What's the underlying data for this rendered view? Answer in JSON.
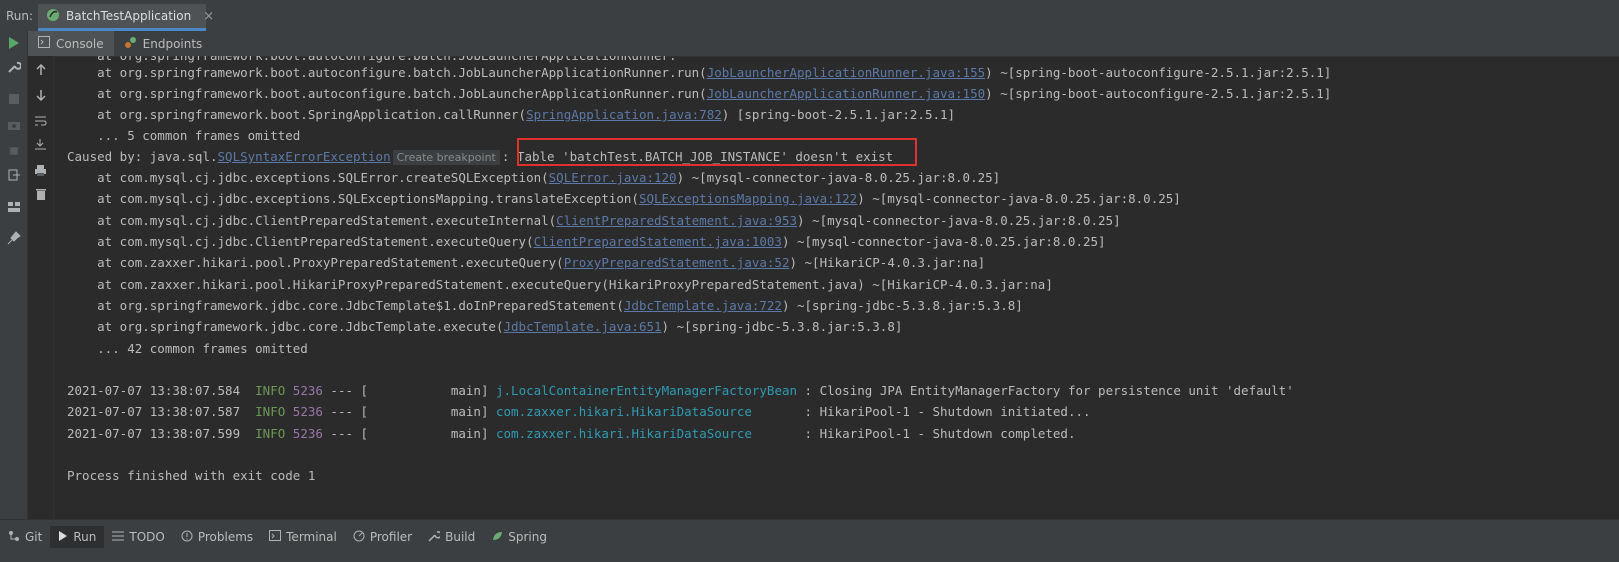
{
  "run_bar": {
    "label": "Run:",
    "tab_label": "BatchTestApplication"
  },
  "tool_tabs": [
    {
      "label": "Console",
      "icon": "console-icon"
    },
    {
      "label": "Endpoints",
      "icon": "endpoints-icon"
    }
  ],
  "console": {
    "lines": [
      "    at org.springframework.boot.autoconfigure.batch.JobLauncherApplicationRunner.run(",
      "    at org.springframework.boot.autoconfigure.batch.JobLauncherApplicationRunner.run(",
      "    at org.springframework.boot.SpringApplication.callRunner(",
      "    ... 5 common frames omitted"
    ],
    "frames_top": [
      {
        "prefix": "    at org.springframework.boot.autoconfigure.batch.JobLauncherApplicationRunner.run(",
        "link": "JobLauncherApplicationRunner.java:155",
        "suffix": ") ~[spring-boot-autoconfigure-2.5.1.jar:2.5.1]"
      },
      {
        "prefix": "    at org.springframework.boot.autoconfigure.batch.JobLauncherApplicationRunner.run(",
        "link": "JobLauncherApplicationRunner.java:150",
        "suffix": ") ~[spring-boot-autoconfigure-2.5.1.jar:2.5.1]"
      },
      {
        "prefix": "    at org.springframework.boot.SpringApplication.callRunner(",
        "link": "SpringApplication.java:782",
        "suffix": ") [spring-boot-2.5.1.jar:2.5.1]"
      }
    ],
    "omitted_1": "    ... 5 common frames omitted",
    "caused_by": {
      "prefix": "Caused by: java.sql.",
      "exception_link": "SQLSyntaxErrorException",
      "breakpoint_hint": "Create breakpoint",
      "separator": ": ",
      "message": "Table 'batchTest.BATCH_JOB_INSTANCE' doesn't exist"
    },
    "frames_cause": [
      {
        "prefix": "    at com.mysql.cj.jdbc.exceptions.SQLError.createSQLException(",
        "link": "SQLError.java:120",
        "suffix": ") ~[mysql-connector-java-8.0.25.jar:8.0.25]"
      },
      {
        "prefix": "    at com.mysql.cj.jdbc.exceptions.SQLExceptionsMapping.translateException(",
        "link": "SQLExceptionsMapping.java:122",
        "suffix": ") ~[mysql-connector-java-8.0.25.jar:8.0.25]"
      },
      {
        "prefix": "    at com.mysql.cj.jdbc.ClientPreparedStatement.executeInternal(",
        "link": "ClientPreparedStatement.java:953",
        "suffix": ") ~[mysql-connector-java-8.0.25.jar:8.0.25]"
      },
      {
        "prefix": "    at com.mysql.cj.jdbc.ClientPreparedStatement.executeQuery(",
        "link": "ClientPreparedStatement.java:1003",
        "suffix": ") ~[mysql-connector-java-8.0.25.jar:8.0.25]"
      },
      {
        "prefix": "    at com.zaxxer.hikari.pool.ProxyPreparedStatement.executeQuery(",
        "link": "ProxyPreparedStatement.java:52",
        "suffix": ") ~[HikariCP-4.0.3.jar:na]"
      },
      {
        "prefix": "    at com.zaxxer.hikari.pool.HikariProxyPreparedStatement.executeQuery(HikariProxyPreparedStatement.java) ~[HikariCP-4.0.3.jar:na]",
        "link": "",
        "suffix": ""
      },
      {
        "prefix": "    at org.springframework.jdbc.core.JdbcTemplate$1.doInPreparedStatement(",
        "link": "JdbcTemplate.java:722",
        "suffix": ") ~[spring-jdbc-5.3.8.jar:5.3.8]"
      },
      {
        "prefix": "    at org.springframework.jdbc.core.JdbcTemplate.execute(",
        "link": "JdbcTemplate.java:651",
        "suffix": ") ~[spring-jdbc-5.3.8.jar:5.3.8]"
      }
    ],
    "omitted_2": "    ... 42 common frames omitted",
    "log_entries": [
      {
        "timestamp": "2021-07-07 13:38:07.584",
        "level": "INFO",
        "pid": "5236",
        "thread": " --- [           main] ",
        "logger": "j.LocalContainerEntityManagerFactoryBean",
        "message": " : Closing JPA EntityManagerFactory for persistence unit 'default'"
      },
      {
        "timestamp": "2021-07-07 13:38:07.587",
        "level": "INFO",
        "pid": "5236",
        "thread": " --- [           main] ",
        "logger": "com.zaxxer.hikari.HikariDataSource      ",
        "message": " : HikariPool-1 - Shutdown initiated..."
      },
      {
        "timestamp": "2021-07-07 13:38:07.599",
        "level": "INFO",
        "pid": "5236",
        "thread": " --- [           main] ",
        "logger": "com.zaxxer.hikari.HikariDataSource      ",
        "message": " : HikariPool-1 - Shutdown completed."
      }
    ],
    "process_exit": "Process finished with exit code 1"
  },
  "bottom_bar": [
    {
      "label": "Git",
      "icon": "git-icon"
    },
    {
      "label": "Run",
      "icon": "run-icon"
    },
    {
      "label": "TODO",
      "icon": "todo-icon"
    },
    {
      "label": "Problems",
      "icon": "problems-icon"
    },
    {
      "label": "Terminal",
      "icon": "terminal-icon"
    },
    {
      "label": "Profiler",
      "icon": "profiler-icon"
    },
    {
      "label": "Build",
      "icon": "build-icon"
    },
    {
      "label": "Spring",
      "icon": "spring-icon"
    }
  ],
  "colors": {
    "background": "#2b2b2b",
    "panel": "#3c3f41",
    "link": "#5c79a8",
    "info": "#6a9955",
    "pid": "#9876aa",
    "logger": "#2e9bb3",
    "error_box": "#e0312d",
    "run_green": "#59a869"
  }
}
